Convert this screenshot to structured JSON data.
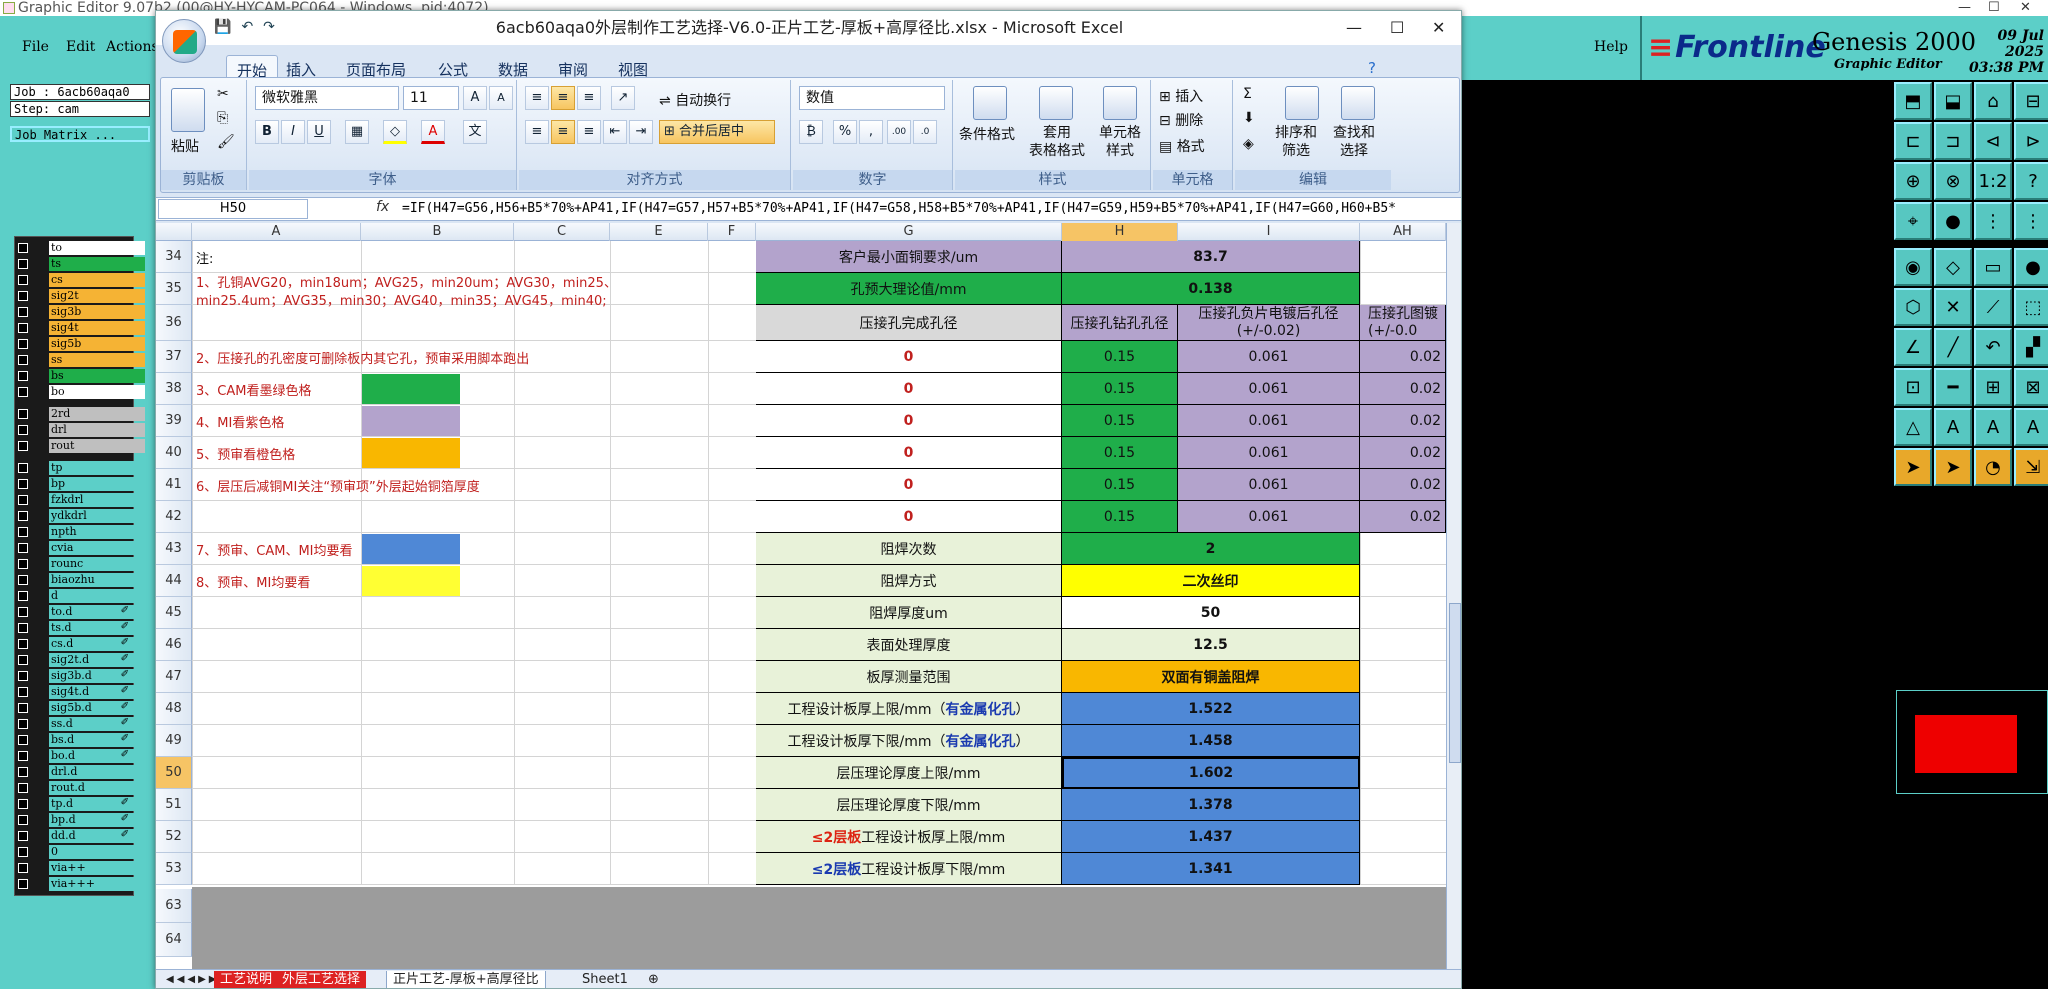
{
  "genesis": {
    "window_title": "Graphic Editor 9.07b2 (00@HY-HYCAM-PC064 - Windows, pid:4072)",
    "menu": [
      "File",
      "Edit",
      "Actions"
    ],
    "help_label": "Help",
    "logo": "Frontline",
    "product": "Genesis 2000",
    "subtitle": "Graphic Editor",
    "date": "09 Jul 2025",
    "time": "03:38 PM",
    "job_label": "Job : 6acb60aqa0",
    "step_label": "Step: cam",
    "job_matrix_label": "Job Matrix ...",
    "layers": [
      {
        "name": "to",
        "color": "#ffffff",
        "mark": ""
      },
      {
        "name": "ts",
        "color": "#1fae4a",
        "mark": ""
      },
      {
        "name": "cs",
        "color": "#f5b334",
        "mark": ""
      },
      {
        "name": "sig2t",
        "color": "#f5b334",
        "mark": ""
      },
      {
        "name": "sig3b",
        "color": "#f5b334",
        "mark": ""
      },
      {
        "name": "sig4t",
        "color": "#f5b334",
        "mark": ""
      },
      {
        "name": "sig5b",
        "color": "#f5b334",
        "mark": ""
      },
      {
        "name": "ss",
        "color": "#f5b334",
        "mark": ""
      },
      {
        "name": "bs",
        "color": "#1fae4a",
        "mark": ""
      },
      {
        "name": "bo",
        "color": "#ffffff",
        "mark": ""
      },
      {
        "name": "2rd",
        "color": "#bfbfbf",
        "mark": ""
      },
      {
        "name": "drl",
        "color": "#bfbfbf",
        "mark": ""
      },
      {
        "name": "rout",
        "color": "#bfbfbf",
        "mark": ""
      },
      {
        "name": "tp",
        "color": "#5ccfc8",
        "mark": ""
      },
      {
        "name": "bp",
        "color": "#5ccfc8",
        "mark": ""
      },
      {
        "name": "fzkdrl",
        "color": "#5ccfc8",
        "mark": ""
      },
      {
        "name": "ydkdrl",
        "color": "#5ccfc8",
        "mark": ""
      },
      {
        "name": "npth",
        "color": "#5ccfc8",
        "mark": ""
      },
      {
        "name": "cvia",
        "color": "#5ccfc8",
        "mark": ""
      },
      {
        "name": "rounc",
        "color": "#5ccfc8",
        "mark": ""
      },
      {
        "name": "biaozhu",
        "color": "#5ccfc8",
        "mark": ""
      },
      {
        "name": "d",
        "color": "#5ccfc8",
        "mark": ""
      },
      {
        "name": "to.d",
        "color": "#5ccfc8",
        "mark": "✐"
      },
      {
        "name": "ts.d",
        "color": "#5ccfc8",
        "mark": "✐"
      },
      {
        "name": "cs.d",
        "color": "#5ccfc8",
        "mark": "✐"
      },
      {
        "name": "sig2t.d",
        "color": "#5ccfc8",
        "mark": "✐"
      },
      {
        "name": "sig3b.d",
        "color": "#5ccfc8",
        "mark": "✐"
      },
      {
        "name": "sig4t.d",
        "color": "#5ccfc8",
        "mark": "✐"
      },
      {
        "name": "sig5b.d",
        "color": "#5ccfc8",
        "mark": "✐"
      },
      {
        "name": "ss.d",
        "color": "#5ccfc8",
        "mark": "✐"
      },
      {
        "name": "bs.d",
        "color": "#5ccfc8",
        "mark": "✐"
      },
      {
        "name": "bo.d",
        "color": "#5ccfc8",
        "mark": "✐"
      },
      {
        "name": "drl.d",
        "color": "#5ccfc8",
        "mark": ""
      },
      {
        "name": "rout.d",
        "color": "#5ccfc8",
        "mark": ""
      },
      {
        "name": "tp.d",
        "color": "#5ccfc8",
        "mark": "✐"
      },
      {
        "name": "bp.d",
        "color": "#5ccfc8",
        "mark": "✐"
      },
      {
        "name": "dd.d",
        "color": "#5ccfc8",
        "mark": "✐"
      },
      {
        "name": "0",
        "color": "#5ccfc8",
        "mark": ""
      },
      {
        "name": "via++",
        "color": "#5ccfc8",
        "mark": ""
      },
      {
        "name": "via+++",
        "color": "#5ccfc8",
        "mark": ""
      }
    ],
    "tools": [
      "⬒",
      "⬓",
      "⌂",
      "⊟",
      "⊏",
      "⊐",
      "⊲",
      "⊳",
      "⊕",
      "⊗",
      "1:2",
      "?",
      "⌖",
      "●",
      "⋮",
      "⋮",
      "◉",
      "◇",
      "▭",
      "●",
      "⬡",
      "✕",
      "⟋",
      "⬚",
      "∠",
      "╱",
      "↶",
      "▞",
      "⊡",
      "━",
      "⊞",
      "⊠",
      "△",
      "A",
      "A",
      "A",
      "➤",
      "➤",
      "◔",
      "⇲"
    ],
    "highlighted_tools": [
      36,
      37,
      38,
      39
    ]
  },
  "excel": {
    "title": "6acb60aqa0外层制作工艺选择-V6.0-正片工艺-厚板+高厚径比.xlsx - Microsoft Excel",
    "tabs": [
      "开始",
      "插入",
      "页面布局",
      "公式",
      "数据",
      "审阅",
      "视图"
    ],
    "ribbon": {
      "paste": "粘贴",
      "clipboard": "剪贴板",
      "font_name": "微软雅黑",
      "font_size": "11",
      "font_group": "字体",
      "wrap": "自动换行",
      "merge": "合并后居中",
      "align_group": "对齐方式",
      "numfmt": "数值",
      "number_group": "数字",
      "cond": "条件格式",
      "table_fmt": "套用\n表格格式",
      "cell_style": "单元格\n样式",
      "style_group": "样式",
      "insert": "插入",
      "delete": "删除",
      "format": "格式",
      "cells_group": "单元格",
      "sort": "排序和\n筛选",
      "find": "查找和\n选择",
      "edit_group": "编辑"
    },
    "name_box": "H50",
    "formula": "=IF(H47=G56,H56+B5*70%+AP41,IF(H47=G57,H57+B5*70%+AP41,IF(H47=G58,H58+B5*70%+AP41,IF(H47=G59,H59+B5*70%+AP41,IF(H47=G60,H60+B5*",
    "columns": [
      "A",
      "B",
      "C",
      "E",
      "F",
      "G",
      "H",
      "I",
      "AH"
    ],
    "rows": [
      "34",
      "35",
      "36",
      "37",
      "38",
      "39",
      "40",
      "41",
      "42",
      "43",
      "44",
      "45",
      "46",
      "47",
      "48",
      "49",
      "50",
      "51",
      "52",
      "53",
      "63",
      "64"
    ],
    "notes": [
      "注:",
      "1、孔铜AVG20，min18um；AVG25，min20um；AVG30，min25、",
      "min25.4um；AVG35，min30；AVG40，min35；AVG45，min40;",
      "2、压接孔的孔密度可删除板内其它孔，预审采用脚本跑出",
      "3、CAM看墨绿色格",
      "4、MI看紫色格",
      "5、预审看橙色格",
      "6、层压后减铜MI关注“预审项”外层起始铜箔厚度",
      "7、预审、CAM、MI均要看",
      "8、预审、MI均要看"
    ],
    "swatches": [
      "#1fae4a",
      "#b3a3cc",
      "#f9b700",
      "#4f88d6",
      "#ffff33"
    ],
    "table": {
      "r34": {
        "g": "客户最小面铜要求/um",
        "h": "83.7"
      },
      "r35": {
        "g": "孔预大理论值/mm",
        "h": "0.138"
      },
      "r36": {
        "g": "压接孔完成孔径",
        "h": "压接孔钻孔孔径",
        "i": "压接孔负片电镀后孔径\n(+/-0.02)",
        "ah": "压接孔图镀\n(+/-0.0"
      },
      "press_rows": [
        {
          "g": "0",
          "h": "0.15",
          "i": "0.061",
          "ah": "0.02"
        },
        {
          "g": "0",
          "h": "0.15",
          "i": "0.061",
          "ah": "0.02"
        },
        {
          "g": "0",
          "h": "0.15",
          "i": "0.061",
          "ah": "0.02"
        },
        {
          "g": "0",
          "h": "0.15",
          "i": "0.061",
          "ah": "0.02"
        },
        {
          "g": "0",
          "h": "0.15",
          "i": "0.061",
          "ah": "0.02"
        },
        {
          "g": "0",
          "h": "0.15",
          "i": "0.061",
          "ah": "0.02"
        }
      ],
      "merged": [
        {
          "g": "阻焊次数",
          "h": "2",
          "fill": "#1fae4a"
        },
        {
          "g": "阻焊方式",
          "h": "二次丝印",
          "fill": "#ffff00"
        },
        {
          "g": "阻焊厚度um",
          "h": "50",
          "fill": "#ffffff"
        },
        {
          "g": "表面处理厚度",
          "h": "12.5",
          "fill": "#e8f2d9"
        },
        {
          "g": "板厚测量范围",
          "h": "双面有铜盖阻焊",
          "fill": "#f9b700"
        },
        {
          "g": "工程设计板厚上限/mm（",
          "g2": "有金属化孔",
          "g3": "）",
          "h": "1.522",
          "fill": "#4f88d6"
        },
        {
          "g": "工程设计板厚下限/mm（",
          "g2": "有金属化孔",
          "g3": "）",
          "h": "1.458",
          "fill": "#4f88d6"
        },
        {
          "g": "层压理论厚度上限/mm",
          "h": "1.602",
          "fill": "#4f88d6"
        },
        {
          "g": "层压理论厚度下限/mm",
          "h": "1.378",
          "fill": "#4f88d6"
        },
        {
          "g0": "≤2层板",
          "g0c": "#d21",
          "g": "工程设计板厚上限/mm",
          "h": "1.437",
          "fill": "#4f88d6"
        },
        {
          "g0": "≤2层板",
          "g0c": "#1a3ab0",
          "g": "工程设计板厚下限/mm",
          "h": "1.341",
          "fill": "#4f88d6"
        }
      ]
    },
    "sheet_tabs": [
      "工艺说明",
      "外层工艺选择",
      "正片工艺-厚板+高厚径比",
      "Sheet1"
    ]
  }
}
